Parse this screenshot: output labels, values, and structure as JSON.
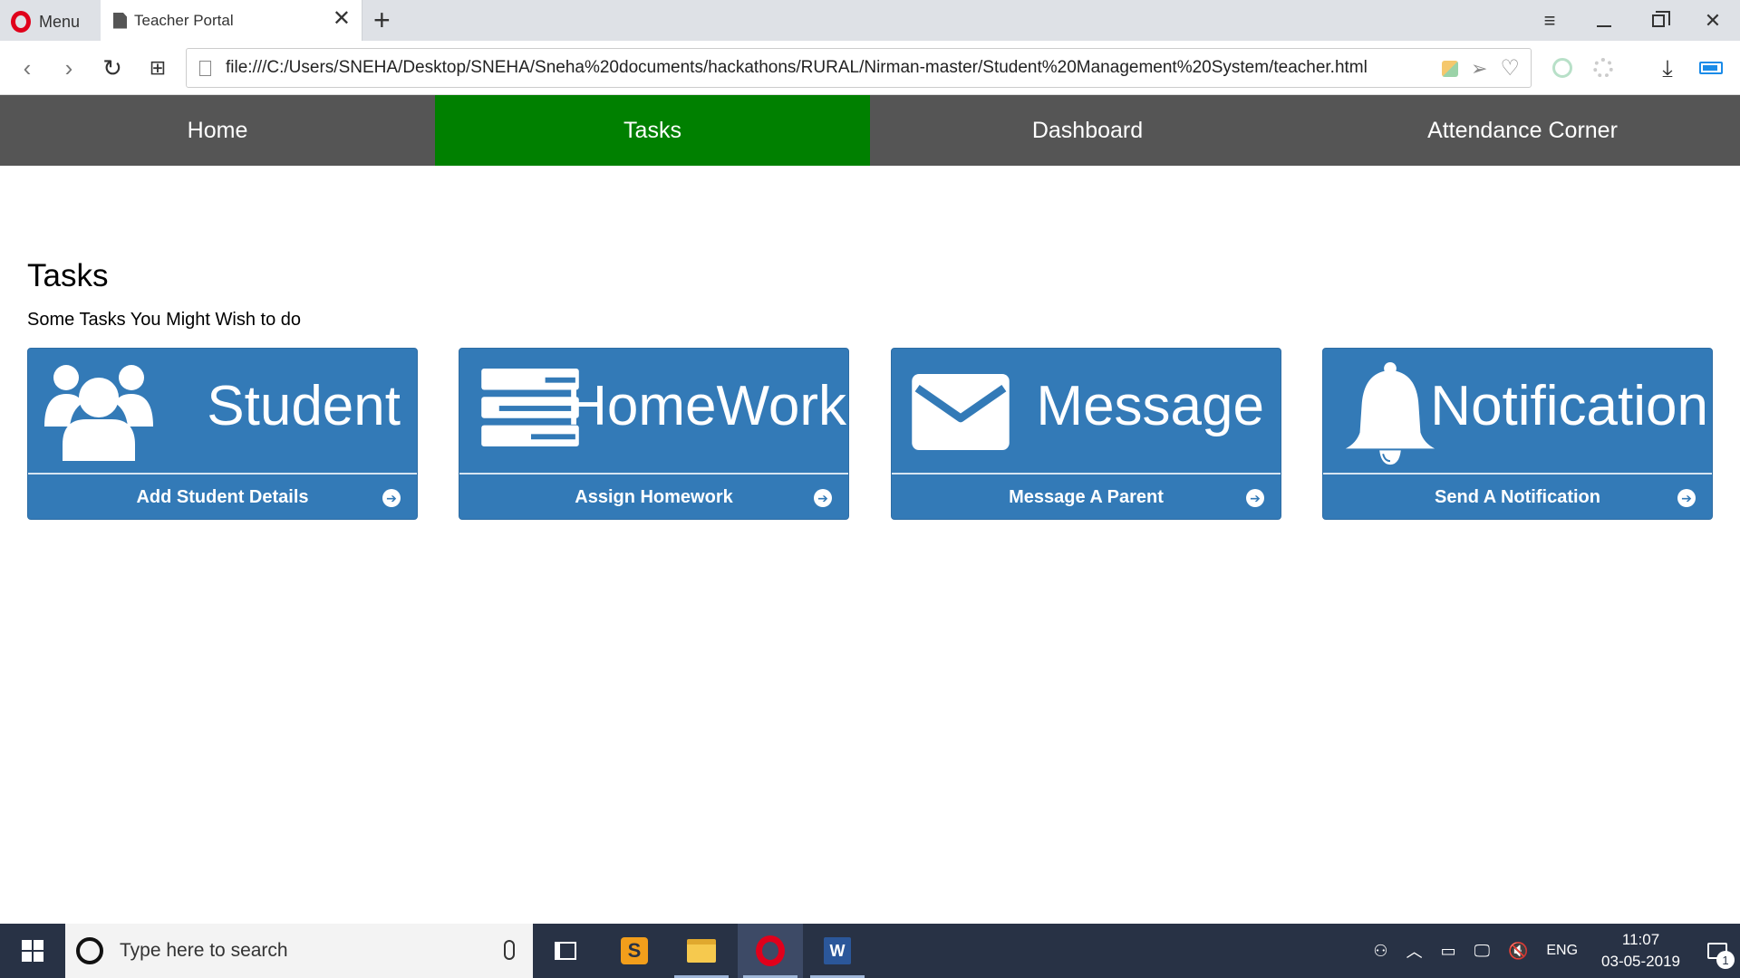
{
  "browser": {
    "menu_label": "Menu",
    "tab_title": "Teacher Portal",
    "url": "file:///C:/Users/SNEHA/Desktop/SNEHA/Sneha%20documents/hackathons/RURAL/Nirman-master/Student%20Management%20System/teacher.html"
  },
  "nav": {
    "items": [
      {
        "label": "Home"
      },
      {
        "label": "Tasks"
      },
      {
        "label": "Dashboard"
      },
      {
        "label": "Attendance Corner"
      }
    ],
    "active_color": "#008000",
    "bar_color": "#555555"
  },
  "page": {
    "title": "Tasks",
    "subtitle": "Some Tasks You Might Wish to do"
  },
  "cards": [
    {
      "title": "Student",
      "action": "Add Student Details",
      "icon": "users-icon"
    },
    {
      "title": "HomeWork",
      "action": "Assign Homework",
      "icon": "tasks-icon"
    },
    {
      "title": "Message",
      "action": "Message A Parent",
      "icon": "envelope-icon"
    },
    {
      "title": "Notification",
      "action": "Send A Notification",
      "icon": "bell-icon"
    }
  ],
  "card_color": "#337ab7",
  "taskbar": {
    "search_placeholder": "Type here to search",
    "language": "ENG",
    "time": "11:07",
    "date": "03-05-2019",
    "notification_count": "1"
  }
}
